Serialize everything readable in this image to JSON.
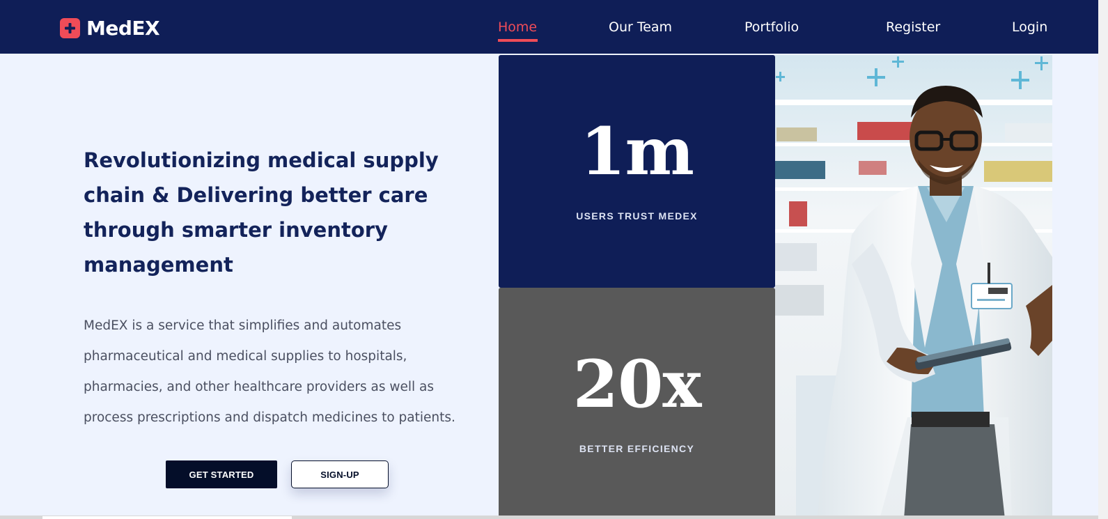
{
  "brand": {
    "name": "MedEX",
    "accent": "#ef4c58",
    "navy": "#0f1e57"
  },
  "nav": {
    "items": [
      {
        "label": "Home",
        "active": true
      },
      {
        "label": "Our Team",
        "active": false
      },
      {
        "label": "Portfolio",
        "active": false
      },
      {
        "label": "Register",
        "active": false
      },
      {
        "label": "Login",
        "active": false
      }
    ]
  },
  "hero": {
    "headline": "Revolutionizing medical supply chain & Delivering better care through smarter inventory management",
    "description": "MedEX is a service that simplifies and automates pharmaceutical and medical supplies to hospitals, pharmacies, and other healthcare providers as well as process prescriptions and dispatch medicines to patients.",
    "primary_button": "GET STARTED",
    "secondary_button": "SIGN-UP"
  },
  "stats": [
    {
      "value": "1m",
      "label": "USERS TRUST MEDEX",
      "color": "#0f1e57"
    },
    {
      "value": "20x",
      "label": "BETTER EFFICIENCY",
      "color": "#595959"
    }
  ],
  "icons": {
    "logo": "plus-icon"
  }
}
